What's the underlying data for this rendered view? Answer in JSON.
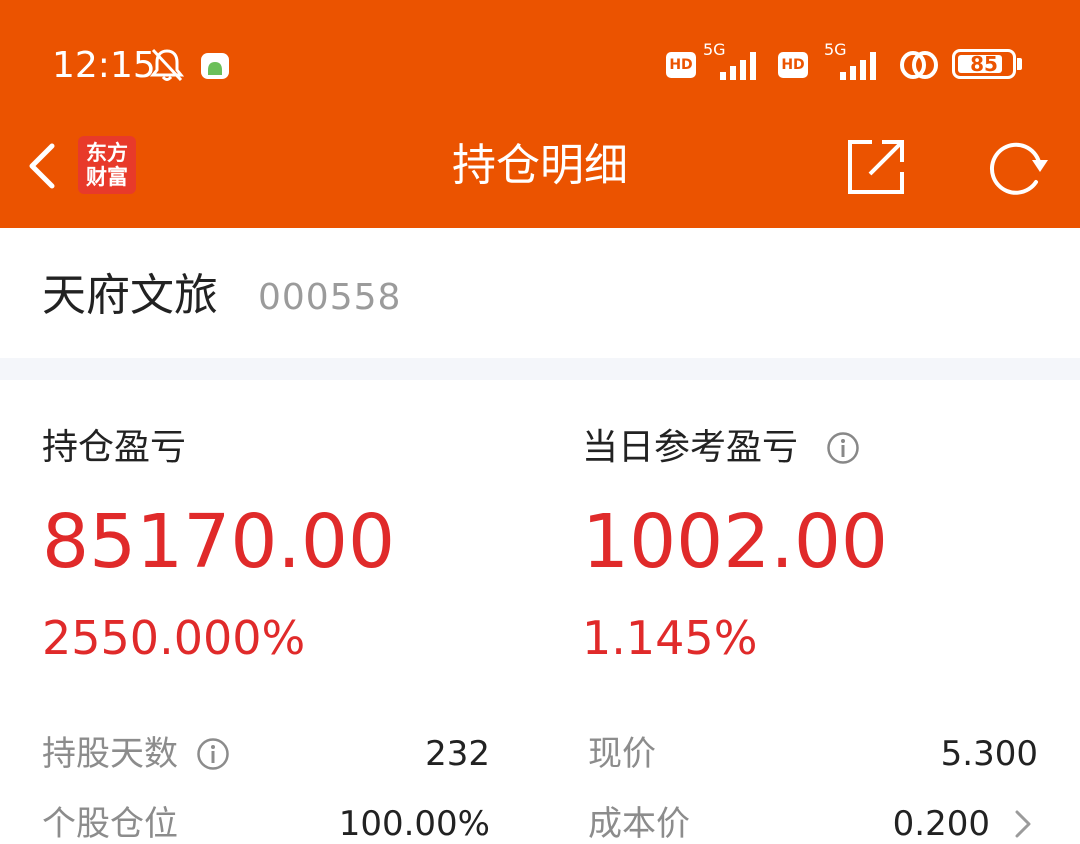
{
  "status_bar": {
    "time": "12:15",
    "hd1": "HD",
    "net1": "5G",
    "hd2": "HD",
    "net2": "5G",
    "battery": "85",
    "battery_level": 0.85
  },
  "nav": {
    "logo_line1": "东方",
    "logo_line2": "财富",
    "title": "持仓明细"
  },
  "stock": {
    "name": "天府文旅",
    "code": "000558"
  },
  "profit": {
    "holding_label": "持仓盈亏",
    "holding_value": "85170.00",
    "holding_pct": "2550.000%",
    "daily_label": "当日参考盈亏",
    "daily_value": "1002.00",
    "daily_pct": "1.145%"
  },
  "details": {
    "days_label": "持股天数",
    "days_value": "232",
    "position_label": "个股仓位",
    "position_value": "100.00%",
    "price_label": "现价",
    "price_value": "5.300",
    "cost_label": "成本价",
    "cost_value": "0.200"
  },
  "colors": {
    "brand": "#EB5300",
    "profit_red": "#E02A2A",
    "logo_red": "#E83A2A"
  }
}
